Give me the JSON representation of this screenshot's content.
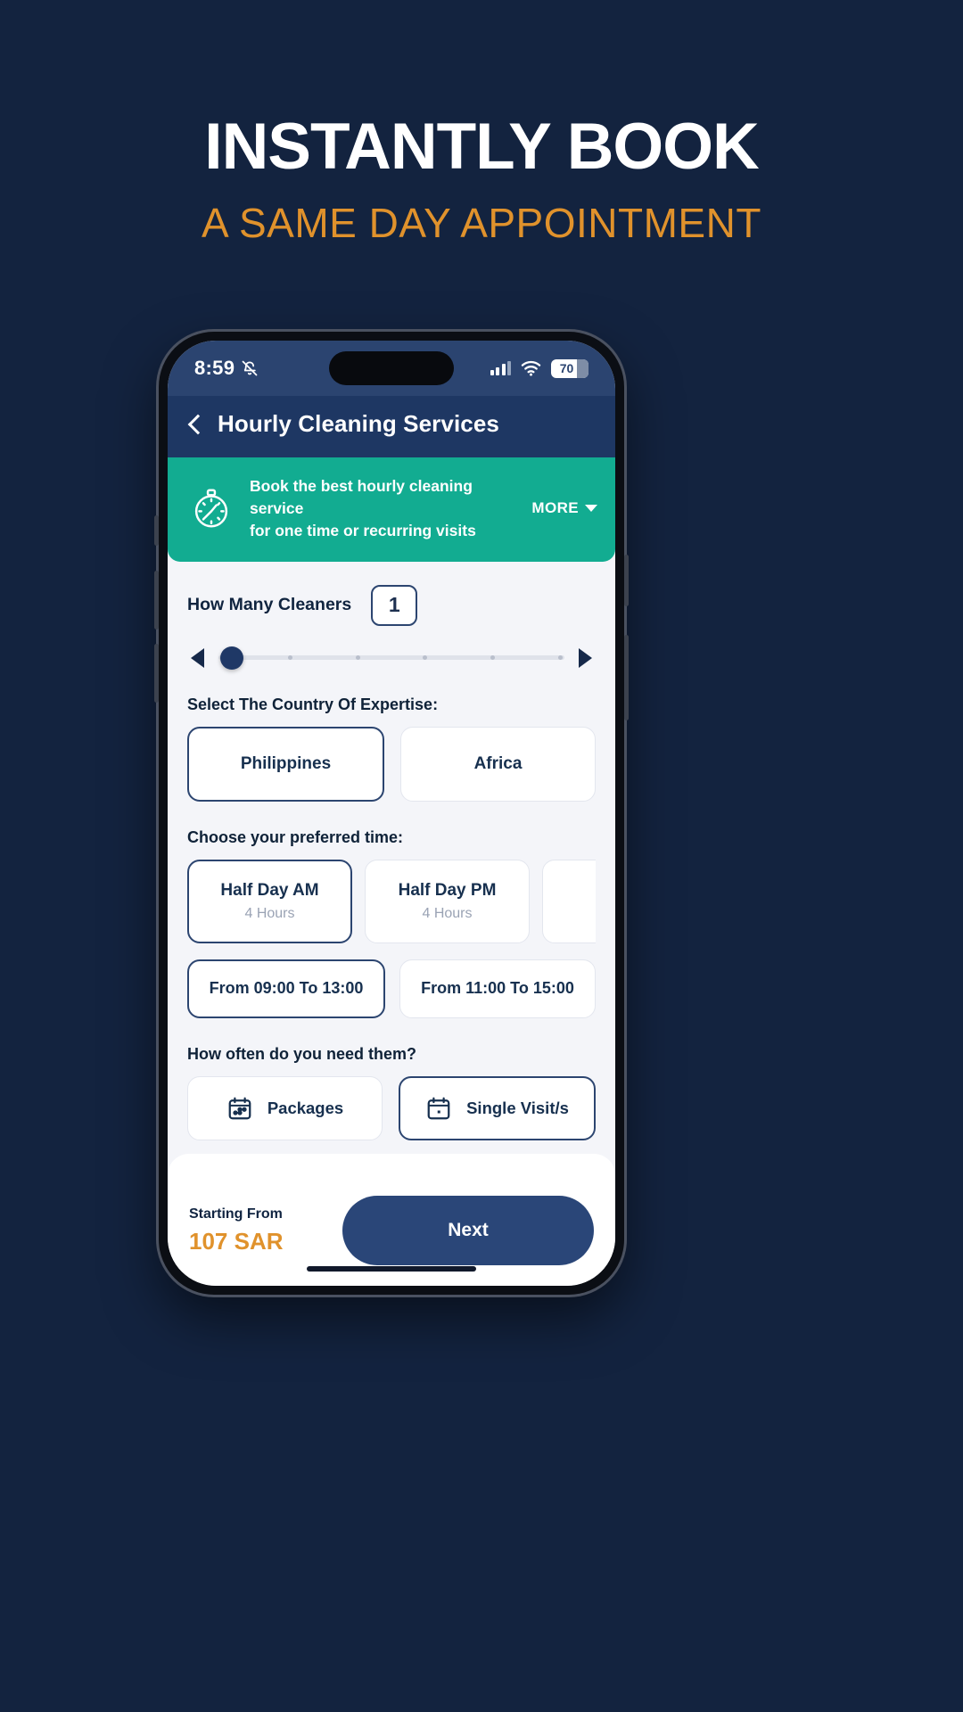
{
  "promo": {
    "title": "INSTANTLY BOOK",
    "subtitle": "A SAME DAY APPOINTMENT",
    "title_color": "#ffffff",
    "subtitle_color": "#e0922c",
    "background_color": "#13233f"
  },
  "status_bar": {
    "time": "8:59",
    "mute_icon": "bell-slash-icon",
    "signal_icon": "cellular-signal-icon",
    "wifi_icon": "wifi-icon",
    "battery_level": "70"
  },
  "app_bar": {
    "back_icon": "back-chevron-icon",
    "title": "Hourly Cleaning Services",
    "background_color": "#1e3763"
  },
  "banner": {
    "icon": "stopwatch-icon",
    "line1": "Book the best hourly cleaning service",
    "line2": "for one time or recurring visits",
    "more_label": "MORE",
    "more_caret_icon": "chevron-down-icon",
    "background_color": "#12ac91"
  },
  "cleaners": {
    "label": "How Many Cleaners",
    "count": "1",
    "prev_icon": "arrow-left-icon",
    "next_icon": "arrow-right-icon",
    "tick_count": 6
  },
  "country": {
    "label": "Select The Country Of Expertise:",
    "options": [
      {
        "label": "Philippines",
        "selected": true
      },
      {
        "label": "Africa",
        "selected": false
      }
    ]
  },
  "preferred_time": {
    "label": "Choose your preferred time:",
    "options": [
      {
        "title": "Half Day AM",
        "sub": "4 Hours",
        "selected": true
      },
      {
        "title": "Half Day PM",
        "sub": "4 Hours",
        "selected": false
      },
      {
        "title": "",
        "sub": "",
        "selected": false,
        "partial": true
      }
    ]
  },
  "time_ranges": {
    "options": [
      {
        "label": "From 09:00 To 13:00",
        "selected": true
      },
      {
        "label": "From 11:00 To 15:00",
        "selected": false
      }
    ]
  },
  "frequency": {
    "label": "How often do you need them?",
    "options": [
      {
        "label": "Packages",
        "icon": "calendar-dots-icon",
        "selected": false
      },
      {
        "label": "Single Visit/s",
        "icon": "calendar-single-icon",
        "selected": true
      }
    ]
  },
  "bottom_bar": {
    "price_label": "Starting From",
    "price_value": "107 SAR",
    "next_label": "Next",
    "next_color": "#2a4678"
  }
}
